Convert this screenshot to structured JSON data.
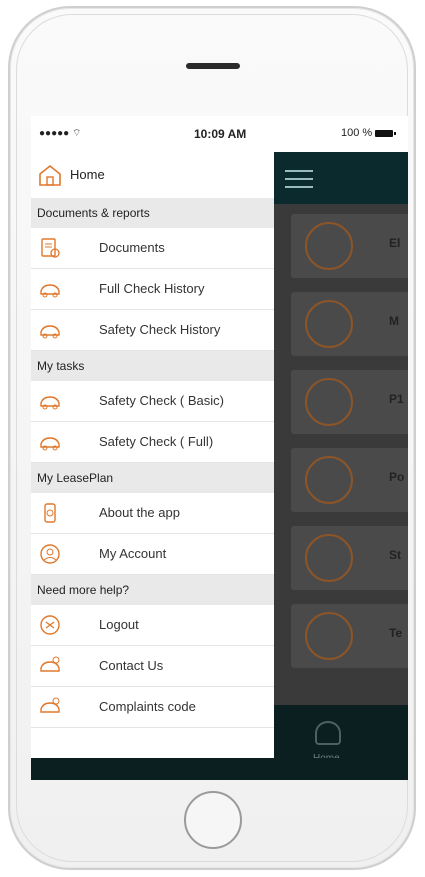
{
  "status_bar": {
    "signal": "●●●●● ⌔",
    "time": "10:09 AM",
    "battery": "100 %"
  },
  "drawer": {
    "home_label": "Home",
    "sections": [
      {
        "title": "Documents & reports",
        "items": [
          "Documents",
          "Full Check History",
          "Safety Check History"
        ]
      },
      {
        "title": "My tasks",
        "items": [
          "Safety Check ( Basic)",
          "Safety Check ( Full)"
        ]
      },
      {
        "title": "My LeasePlan",
        "items": [
          "About the app",
          "My Account"
        ]
      },
      {
        "title": "Need more help?",
        "items": [
          "Logout",
          "Contact Us",
          "Complaints code"
        ]
      }
    ]
  },
  "background_app": {
    "card_labels": [
      "El",
      "M",
      "P1",
      "Po",
      "St",
      "Te"
    ],
    "bottom_nav_label": "Home"
  },
  "colors": {
    "accent": "#E0782C",
    "header": "#0B2A2D",
    "section_bg": "#E9E9E9"
  }
}
